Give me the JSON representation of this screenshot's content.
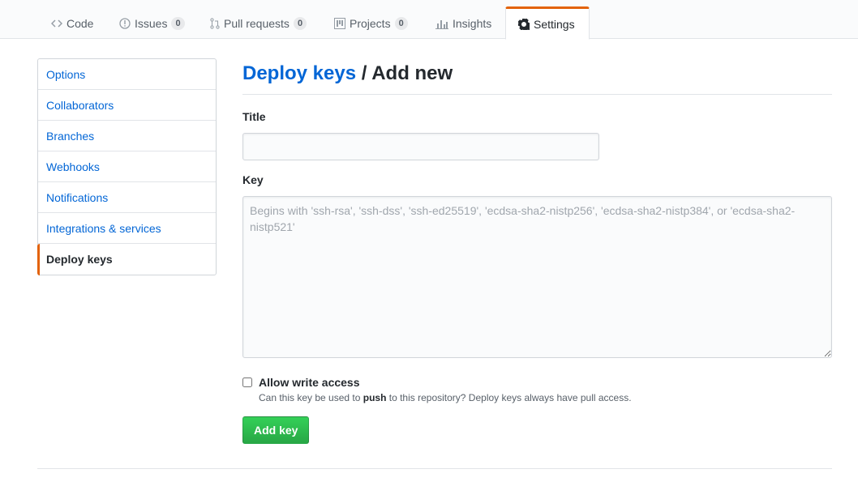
{
  "repo_nav": {
    "tabs": [
      {
        "label": "Code",
        "icon": "code-icon",
        "counter": null
      },
      {
        "label": "Issues",
        "icon": "issue-opened-icon",
        "counter": "0"
      },
      {
        "label": "Pull requests",
        "icon": "git-pull-request-icon",
        "counter": "0"
      },
      {
        "label": "Projects",
        "icon": "project-icon",
        "counter": "0"
      },
      {
        "label": "Insights",
        "icon": "graph-icon",
        "counter": null
      },
      {
        "label": "Settings",
        "icon": "gear-icon",
        "counter": null,
        "selected": true
      }
    ]
  },
  "sidebar": {
    "items": [
      {
        "label": "Options"
      },
      {
        "label": "Collaborators"
      },
      {
        "label": "Branches"
      },
      {
        "label": "Webhooks"
      },
      {
        "label": "Notifications"
      },
      {
        "label": "Integrations & services"
      },
      {
        "label": "Deploy keys",
        "selected": true
      }
    ]
  },
  "main": {
    "breadcrumb_link": "Deploy keys",
    "breadcrumb_separator": " / ",
    "breadcrumb_current": "Add new",
    "title_label": "Title",
    "title_value": "",
    "key_label": "Key",
    "key_value": "",
    "key_placeholder": "Begins with 'ssh-rsa', 'ssh-dss', 'ssh-ed25519', 'ecdsa-sha2-nistp256', 'ecdsa-sha2-nistp384', or 'ecdsa-sha2-nistp521'",
    "write_access_label": "Allow write access",
    "write_access_checked": false,
    "note_before": "Can this key be used to ",
    "note_bold": "push",
    "note_after": " to this repository? Deploy keys always have pull access.",
    "submit_label": "Add key"
  },
  "colors": {
    "accent": "#e36209",
    "link": "#0366d6",
    "primary_button": "#28a745"
  }
}
